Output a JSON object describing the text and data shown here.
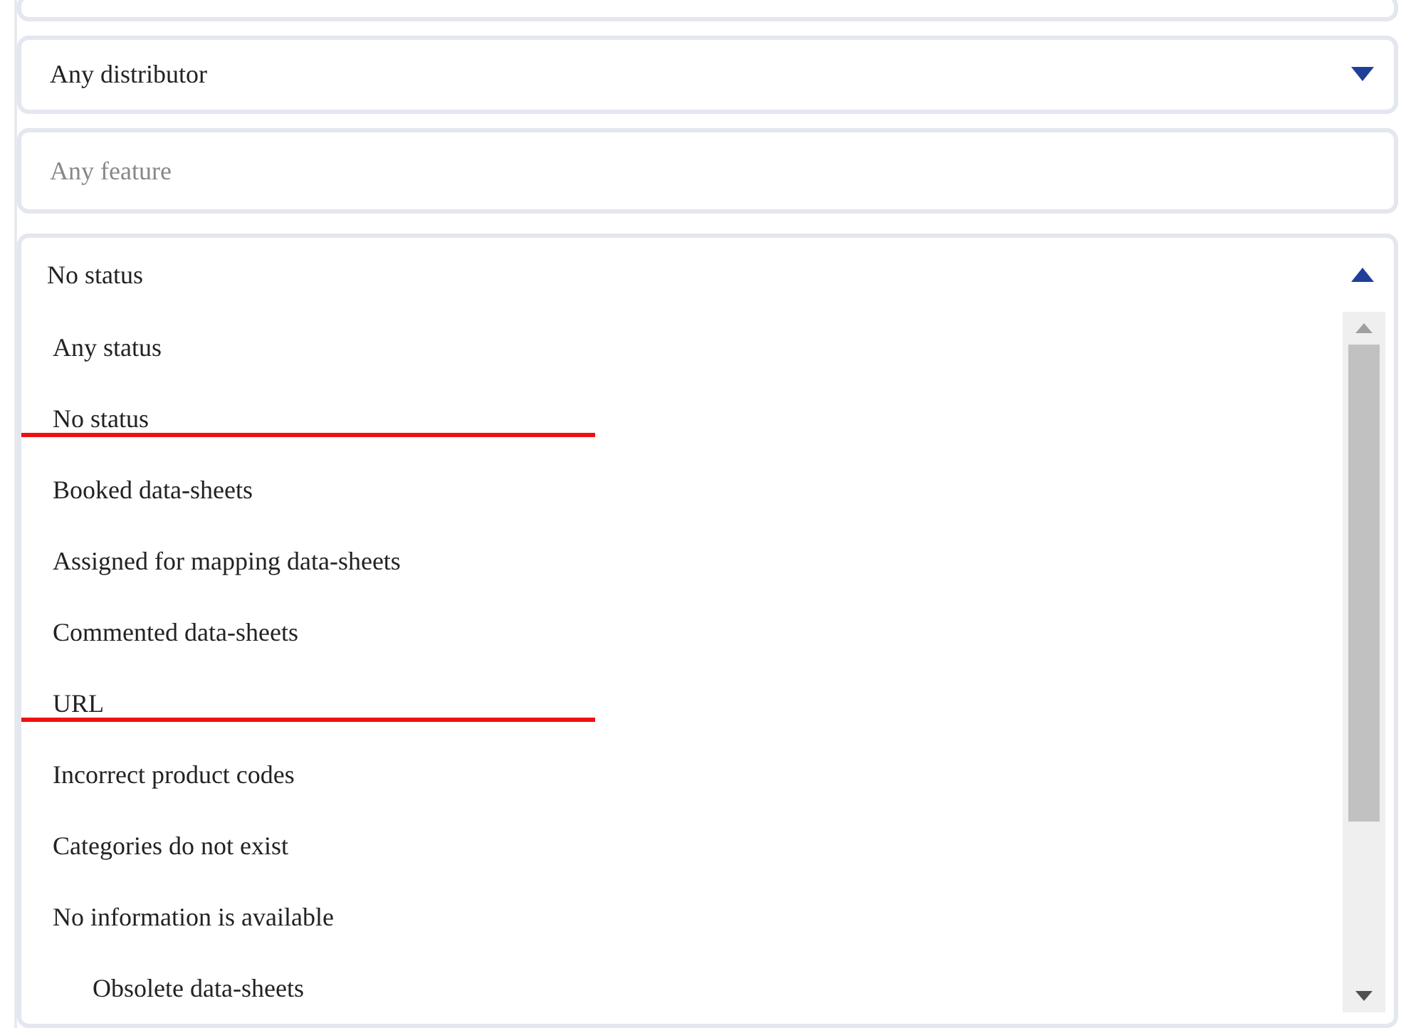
{
  "distributor_select": {
    "value": "Any distributor",
    "expanded": false
  },
  "feature_field": {
    "placeholder": "Any feature"
  },
  "status_select": {
    "value": "No status",
    "expanded": true,
    "options": [
      {
        "label": "Any status",
        "kind": "option",
        "annotation_underline": false
      },
      {
        "label": "No status",
        "kind": "option",
        "annotation_underline": true
      },
      {
        "label": "Booked data-sheets",
        "kind": "option",
        "annotation_underline": false
      },
      {
        "label": "Assigned for mapping data-sheets",
        "kind": "option",
        "annotation_underline": false
      },
      {
        "label": "Commented data-sheets",
        "kind": "option",
        "annotation_underline": false
      },
      {
        "label": "URL",
        "kind": "option",
        "annotation_underline": true
      },
      {
        "label": "Incorrect product codes",
        "kind": "option",
        "annotation_underline": false
      },
      {
        "label": "Categories do not exist",
        "kind": "option",
        "annotation_underline": false
      },
      {
        "label": "No information is available",
        "kind": "option",
        "annotation_underline": false
      },
      {
        "label": "Obsolete data-sheets",
        "kind": "suboption",
        "annotation_underline": false
      }
    ]
  }
}
